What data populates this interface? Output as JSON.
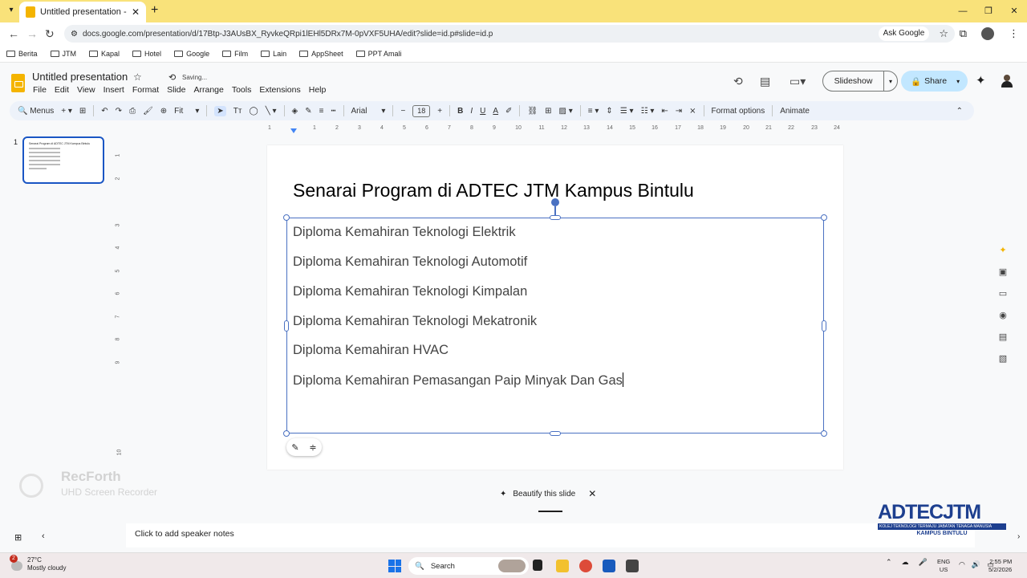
{
  "browser": {
    "tab_title": "Untitled presentation - Google",
    "url": "docs.google.com/presentation/d/17Btp-J3AUsBX_RyvkeQRpi1lEHl5DRx7M-0pVXF5UHA/edit?slide=id.p#slide=id.p",
    "ask_google": "Ask Google",
    "bookmarks": [
      "Berita",
      "JTM",
      "Kapal",
      "Hotel",
      "Google",
      "Film",
      "Lain",
      "AppSheet",
      "PPT Amali"
    ]
  },
  "app": {
    "doc_title": "Untitled presentation",
    "save_status": "Saving...",
    "menu": [
      "File",
      "Edit",
      "View",
      "Insert",
      "Format",
      "Slide",
      "Arrange",
      "Tools",
      "Extensions",
      "Help"
    ],
    "slideshow_label": "Slideshow",
    "share_label": "Share"
  },
  "toolbar": {
    "menus_label": "Menus",
    "zoom": "Fit",
    "font": "Arial",
    "font_size": "18",
    "format_options": "Format options",
    "animate": "Animate"
  },
  "ruler": {
    "h_ticks": [
      "1",
      "1",
      "2",
      "3",
      "4",
      "5",
      "6",
      "7",
      "8",
      "9",
      "10",
      "11",
      "12",
      "13",
      "14",
      "15",
      "16",
      "17",
      "18",
      "19",
      "20",
      "21",
      "22",
      "23",
      "24"
    ],
    "v_ticks": [
      "1",
      "2",
      "3",
      "4",
      "5",
      "6",
      "7",
      "8",
      "9",
      "10"
    ]
  },
  "filmstrip": {
    "slide_number": "1",
    "thumb_title": "Senarai Program di ADTEC JTM Kampus Bintulu"
  },
  "slide": {
    "title": "Senarai Program di ADTEC JTM Kampus Bintulu",
    "items": [
      "Diploma Kemahiran Teknologi Elektrik",
      "Diploma Kemahiran Teknologi Automotif",
      "Diploma Kemahiran Teknologi Kimpalan",
      "Diploma Kemahiran Teknologi Mekatronik",
      "Diploma Kemahiran HVAC",
      "Diploma Kemahiran Pemasangan Paip Minyak Dan Gas"
    ]
  },
  "beautify_label": "Beautify this slide",
  "notes_placeholder": "Click to add speaker notes",
  "watermark": {
    "name": "RecForth",
    "subtitle": "UHD Screen Recorder"
  },
  "logo": {
    "main": "ADTEC",
    "jtm": "JTM",
    "bar_text": "KOLEJ TEKNOLOGI TERMAJU JABATAN TENAGA MANUSIA",
    "sub": "KAMPUS BINTULU"
  },
  "taskbar": {
    "temp": "27°C",
    "weather": "Mostly cloudy",
    "weather_badge": "2",
    "search": "Search",
    "lang1": "ENG",
    "lang2": "US",
    "time": "2:55 PM",
    "date": "5/2/2026"
  }
}
